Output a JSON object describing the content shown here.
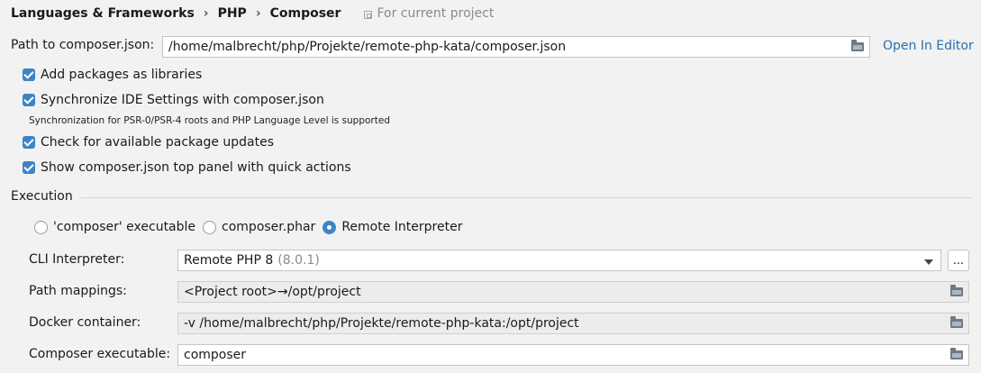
{
  "breadcrumb": {
    "items": [
      "Languages & Frameworks",
      "PHP",
      "Composer"
    ],
    "separator": "›",
    "scope_label": "For current project"
  },
  "composer_json": {
    "label": "Path to composer.json:",
    "value": "/home/malbrecht/php/Projekte/remote-php-kata/composer.json",
    "open_in_editor": "Open In Editor"
  },
  "options": {
    "add_packages": {
      "label": "Add packages as libraries",
      "checked": true
    },
    "sync_ide": {
      "label": "Synchronize IDE Settings with composer.json",
      "checked": true
    },
    "sync_hint": "Synchronization for PSR-0/PSR-4 roots and PHP Language Level is supported",
    "check_updates": {
      "label": "Check for available package updates",
      "checked": true
    },
    "show_panel": {
      "label": "Show composer.json top panel with quick actions",
      "checked": true
    }
  },
  "execution": {
    "title": "Execution",
    "radios": [
      {
        "label": "'composer' executable",
        "selected": false
      },
      {
        "label": "composer.phar",
        "selected": false
      },
      {
        "label": "Remote Interpreter",
        "selected": true
      }
    ],
    "cli_interpreter": {
      "label": "CLI Interpreter:",
      "value": "Remote PHP 8",
      "version": "(8.0.1)",
      "more_button": "..."
    },
    "path_mappings": {
      "label": "Path mappings:",
      "value": "<Project root>→/opt/project"
    },
    "docker_container": {
      "label": "Docker container:",
      "value": "-v /home/malbrecht/php/Projekte/remote-php-kata:/opt/project"
    },
    "composer_executable": {
      "label": "Composer executable:",
      "value": "composer"
    }
  },
  "colors": {
    "accent": "#3d84c4",
    "link": "#2470b3",
    "background": "#f2f2f2"
  }
}
